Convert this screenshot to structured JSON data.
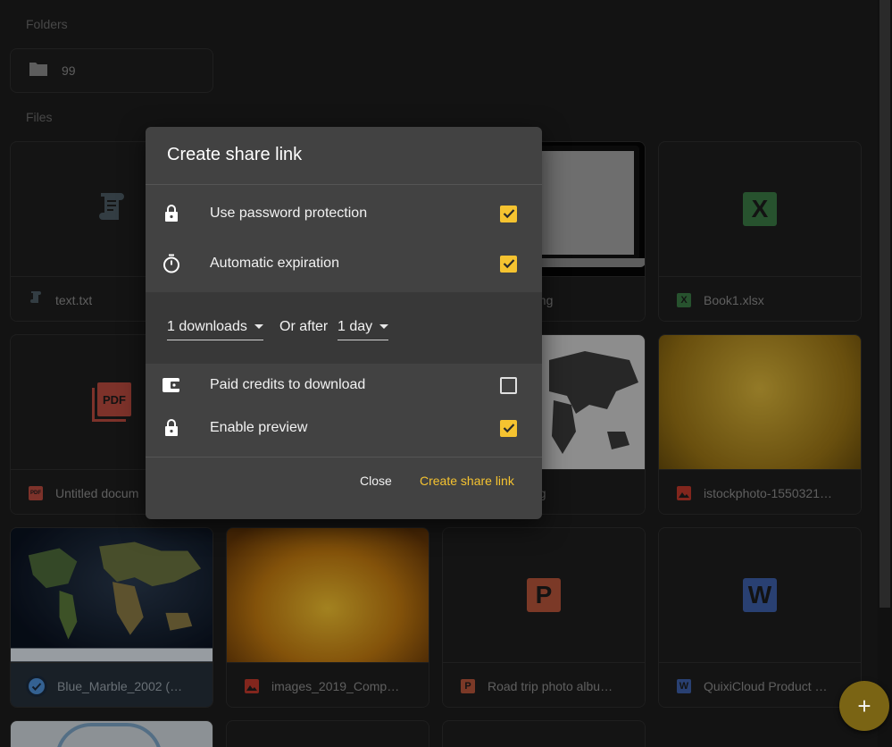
{
  "page": {
    "folders_label": "Folders",
    "files_label": "Files",
    "folder": {
      "name": "99",
      "icon": "folder-icon"
    },
    "files": [
      {
        "name": "text.txt",
        "icon": "text-file-icon"
      },
      {
        "name": "ong",
        "icon": "image-icon"
      },
      {
        "name": "Book1.xlsx",
        "icon": "excel-icon",
        "letter": "X",
        "color": "#3a7a44"
      },
      {
        "name": "Untitled docum",
        "icon": "pdf-icon",
        "letter": "PDF",
        "color": "#b84a3f"
      },
      {
        "name": "pg",
        "icon": "image-icon"
      },
      {
        "name": "istockphoto-1550321…",
        "icon": "image-icon",
        "color": "#c0392b"
      },
      {
        "name": "Blue_Marble_2002 (…",
        "icon": "check-circle-icon"
      },
      {
        "name": "images_2019_Comp…",
        "icon": "image-icon",
        "color": "#c0392b"
      },
      {
        "name": "Road trip photo albu…",
        "icon": "powerpoint-icon",
        "letter": "P",
        "color": "#b5543a"
      },
      {
        "name": "QuixiCloud Product …",
        "icon": "word-icon",
        "letter": "W",
        "color": "#3d5fa8"
      }
    ],
    "fab": {
      "label": "+",
      "icon": "plus-icon"
    }
  },
  "dialog": {
    "title": "Create share link",
    "options": [
      {
        "label": "Use password protection",
        "icon": "lock-icon",
        "checked": true
      },
      {
        "label": "Automatic expiration",
        "icon": "timer-icon",
        "checked": true
      },
      {
        "label": "Paid credits to download",
        "icon": "wallet-icon",
        "checked": false
      },
      {
        "label": "Enable preview",
        "icon": "lock-icon",
        "checked": true
      }
    ],
    "expiration": {
      "downloads_value": "1 downloads",
      "or_after": "Or after",
      "time_value": "1 day"
    },
    "close_label": "Close",
    "create_label": "Create share link"
  },
  "colors": {
    "accent": "#f5c330",
    "dialog_bg": "#424242"
  }
}
